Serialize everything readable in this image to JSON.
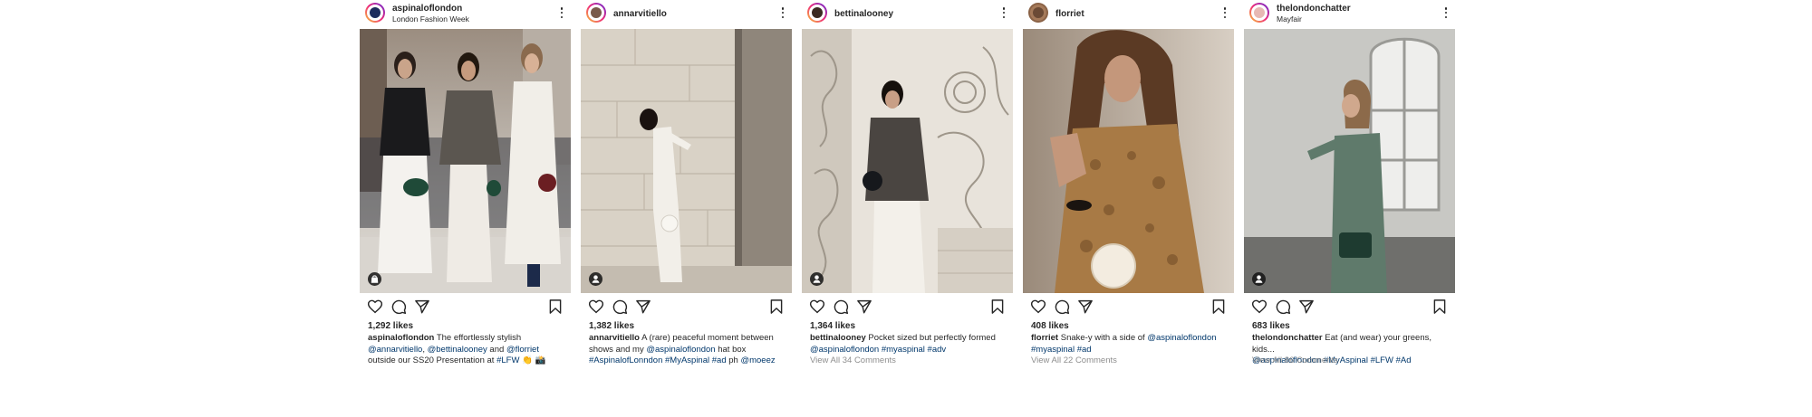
{
  "posts": [
    {
      "username": "aspinaloflondon",
      "location": "London Fashion Week",
      "likes": "1,292 likes",
      "caption": {
        "user": "aspinaloflondon",
        "t1": " The effortlessly stylish ",
        "m1": "@annarvitiello",
        "t2": ", ",
        "m2": "@bettinalooney",
        "t3": " and ",
        "m3": "@florriet",
        "t4": " outside our SS20 Presentation at ",
        "h1": "#LFW",
        "t5": " 👏 📸"
      },
      "photo_alt": "Three women on a London street",
      "tag_icon": "bag-icon"
    },
    {
      "username": "annarvitiello",
      "location": "",
      "likes": "1,382 likes",
      "caption": {
        "user": "annarvitiello",
        "t1": " A (rare) peaceful moment between shows and my ",
        "m1": "@aspinaloflondon",
        "t2": " hat box ",
        "h1": "#AspinalofLonndon",
        "t3": " ",
        "h2": "#MyAspinal",
        "t4": " ",
        "h3": "#ad",
        "t5": " ph ",
        "m2": "@moeez"
      },
      "tag_icon": "user-tag-icon"
    },
    {
      "username": "bettinalooney",
      "location": "",
      "likes": "1,364 likes",
      "caption": {
        "user": "bettinalooney",
        "t1": " Pocket sized but perfectly formed ",
        "m1": "@aspinaloflondon",
        "t2": " ",
        "h1": "#myaspinal",
        "t3": " ",
        "h2": "#adv"
      },
      "comments": "View All 34 Comments",
      "tag_icon": "user-tag-icon"
    },
    {
      "username": "florriet",
      "location": "",
      "likes": "408 likes",
      "caption": {
        "user": "florriet",
        "t1": " Snake-y with a side of ",
        "m1": "@aspinaloflondon",
        "t2": " ",
        "h1": "#myaspinal",
        "t3": " ",
        "h2": "#ad"
      },
      "comments": "View All 22 Comments"
    },
    {
      "username": "thelondonchatter",
      "location": "Mayfair",
      "likes": "683 likes",
      "caption": {
        "user": "thelondonchatter",
        "t1": " Eat (and wear) your greens, kids...",
        "m1": "@aspinaloflondon",
        "t2": " ",
        "h1": "#MyAspinal",
        "t3": " ",
        "h2": "#LFW",
        "t4": " ",
        "h3": "#Ad"
      },
      "comments": "View All 86 Comments",
      "tag_icon": "user-tag-icon"
    }
  ],
  "icons": {
    "like": "heart-icon",
    "comment": "comment-icon",
    "share": "send-icon",
    "save": "bookmark-icon",
    "more": "more-options-icon"
  },
  "colors": {
    "text": "#262626",
    "link": "#00376b",
    "muted": "#8e8e8e"
  }
}
